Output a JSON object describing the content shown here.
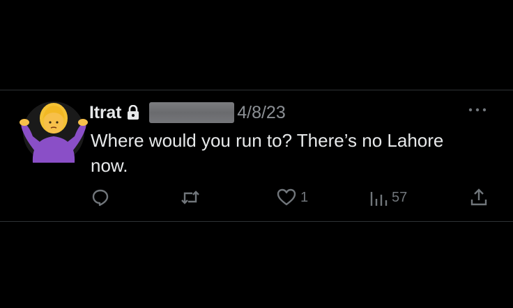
{
  "tweet": {
    "author_name": "Itrat",
    "date": "4/8/23",
    "text": "Where would you run to? There’s no Lahore\nnow.",
    "likes": "1",
    "views": "57"
  },
  "icons": {
    "avatar": "woman-shrugging-emoji",
    "lock": "lock-icon",
    "more": "more-options-icon",
    "reply": "reply-icon",
    "retweet": "retweet-icon",
    "like": "heart-icon",
    "views": "views-icon",
    "share": "share-icon"
  },
  "colors": {
    "background": "#000000",
    "text_primary": "#e7e9ea",
    "text_secondary": "#71767b",
    "divider": "#2f3336"
  }
}
